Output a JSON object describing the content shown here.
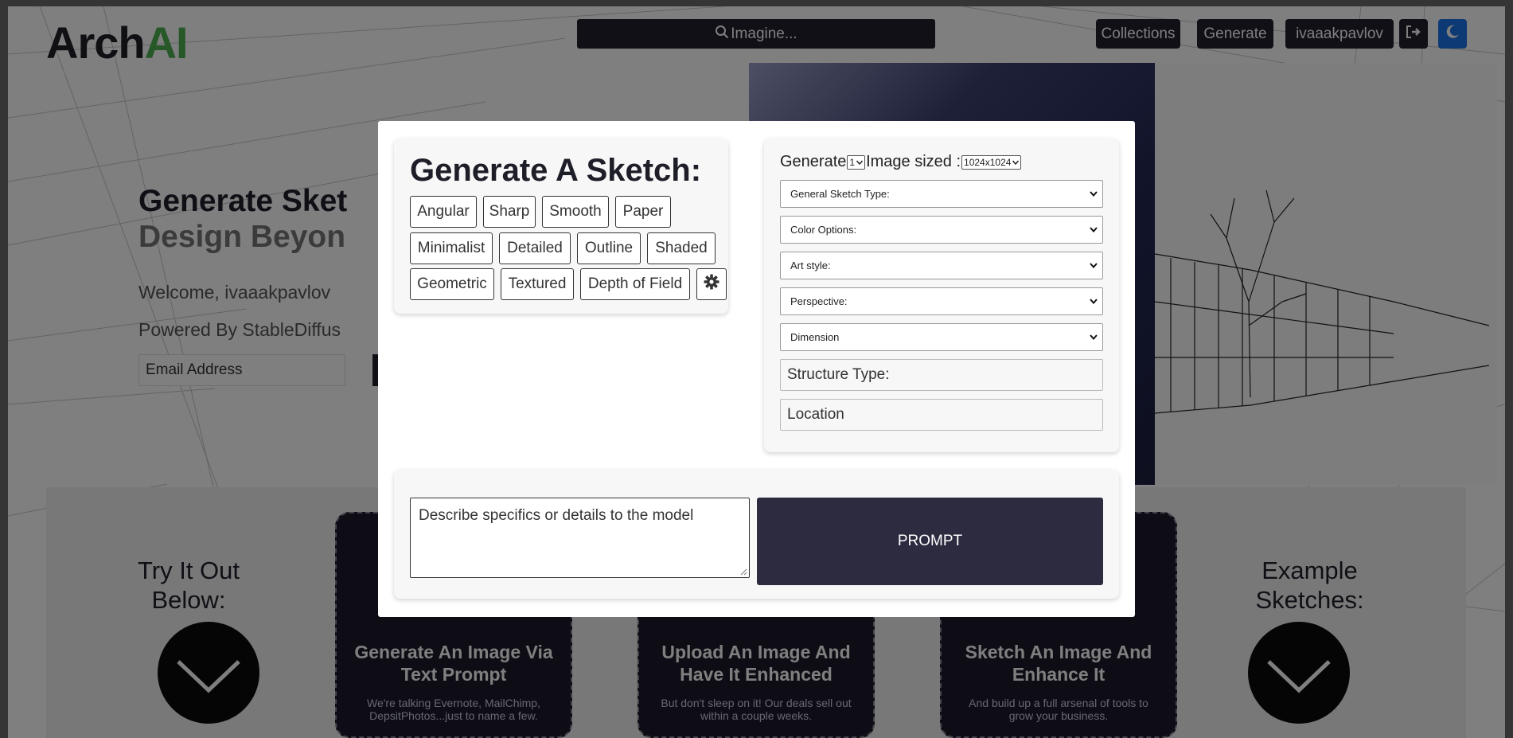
{
  "brand": {
    "logo_part1": "Arch",
    "logo_part2": "AI",
    "accent": "#4cb050"
  },
  "header": {
    "search_label": "Imagine...",
    "nav": {
      "collections": "Collections",
      "generate": "Generate",
      "user": "ivaaakpavlov"
    },
    "theme_color": "#1a73e8"
  },
  "hero": {
    "title_line1": "Generate Sket",
    "title_line2": "Design Beyon",
    "welcome": "Welcome, ivaaakpavlov",
    "powered": "Powered By StableDiffus",
    "email_placeholder": "Email Address"
  },
  "features": {
    "try_text": "Try It Out Below:",
    "example_text": "Example Sketches:",
    "cards": [
      {
        "title": "Generate An Image Via Text Prompt",
        "desc": "We're talking Evernote, MailChimp, DepsitPhotos...just to name a few."
      },
      {
        "title": "Upload An Image And Have It Enhanced",
        "desc": "But don't sleep on it! Our deals sell out within a couple weeks."
      },
      {
        "title": "Sketch An Image And Enhance It",
        "desc": "And build up a full arsenal of tools to grow your business."
      }
    ]
  },
  "modal": {
    "tags_title": "Generate A Sketch:",
    "tags": [
      "Angular",
      "Sharp",
      "Smooth",
      "Paper",
      "Minimalist",
      "Detailed",
      "Outline",
      "Shaded",
      "Geometric",
      "Textured",
      "Depth of Field"
    ],
    "generate_label": "Generate",
    "count_value": "1",
    "size_label": "Image sized :",
    "size_value": "1024x1024",
    "selects": {
      "sketch_type": "General Sketch Type:",
      "color_options": "Color Options:",
      "art_style": "Art style:",
      "perspective": "Perspective:",
      "dimension": "Dimension"
    },
    "structure_placeholder": "Structure Type:",
    "location_placeholder": "Location",
    "prompt_placeholder": "Describe specifics or details to the model",
    "prompt_button": "PROMPT"
  }
}
